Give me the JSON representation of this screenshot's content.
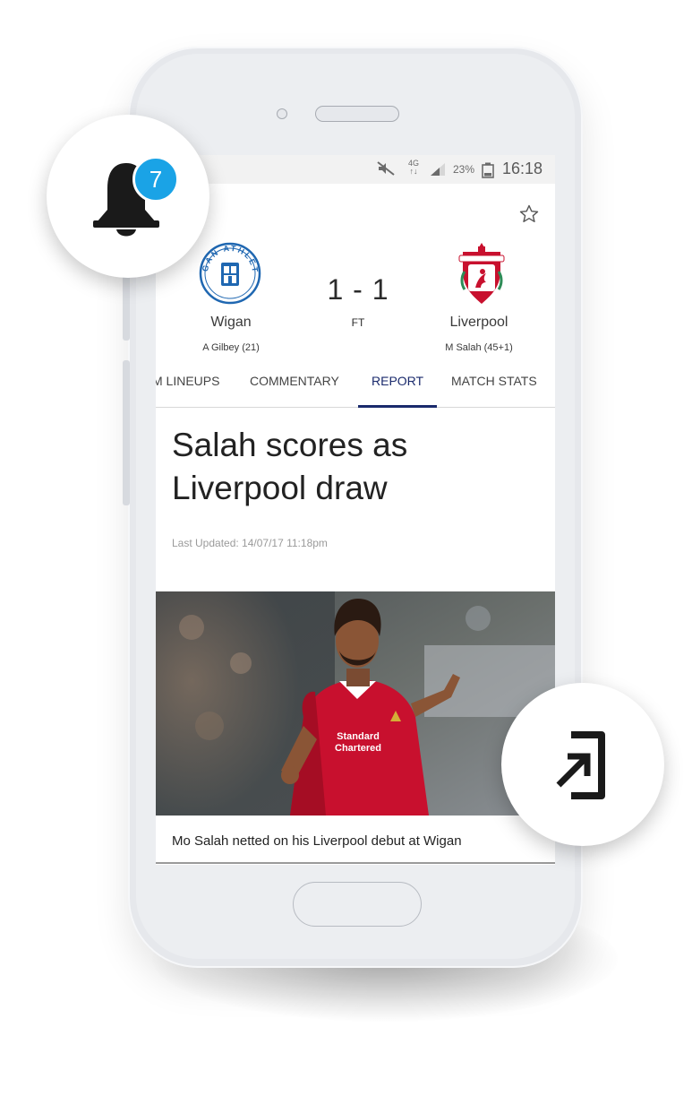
{
  "status_bar": {
    "network_top": "4G",
    "network_bottom": "↑↓",
    "battery_percent": "23%",
    "time": "16:18"
  },
  "notifications": {
    "count": "7"
  },
  "match": {
    "home_team": "Wigan",
    "home_scorer": "A Gilbey (21)",
    "away_team": "Liverpool",
    "away_scorer": "M Salah (45+1)",
    "score": "1 - 1",
    "status": "FT",
    "home_crest_text": "WIGAN ATHLETIC",
    "away_crest_text": "LIVERPOOL"
  },
  "tabs": [
    {
      "label": "M LINEUPS"
    },
    {
      "label": "COMMENTARY"
    },
    {
      "label": "REPORT",
      "active": true
    },
    {
      "label": "MATCH STATS"
    }
  ],
  "article": {
    "headline_line1": "Salah scores as",
    "headline_line2": "Liverpool draw",
    "last_updated": "Last Updated: 14/07/17 11:18pm",
    "caption": "Mo Salah netted on his Liverpool debut at Wigan",
    "shirt_sponsor_line1": "Standard",
    "shirt_sponsor_line2": "Chartered"
  },
  "colors": {
    "accent_navy": "#1a2a6c",
    "badge_blue": "#1aa3e6",
    "liverpool_red": "#c8102e"
  }
}
